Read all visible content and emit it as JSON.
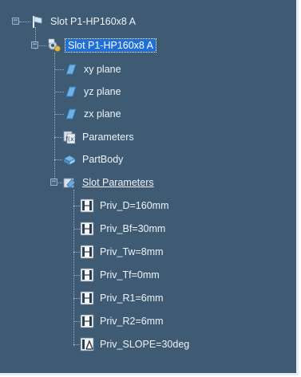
{
  "tree": {
    "root": {
      "label": "Slot P1-HP160x8 A",
      "icon": "part-flag-icon"
    },
    "part": {
      "label": "Slot P1-HP160x8 A",
      "icon": "part-gears-icon",
      "selected": true
    },
    "planes": [
      {
        "label": "xy plane",
        "icon": "plane-icon"
      },
      {
        "label": "yz plane",
        "icon": "plane-icon"
      },
      {
        "label": "zx plane",
        "icon": "plane-icon"
      }
    ],
    "parameters": {
      "label": "Parameters",
      "icon": "parameters-icon"
    },
    "partbody": {
      "label": "PartBody",
      "icon": "partbody-icon"
    },
    "slot_parameters": {
      "label": "Slot Parameters",
      "icon": "parameter-set-icon",
      "items": [
        {
          "label": "Priv_D=160mm",
          "icon": "length-parameter-icon"
        },
        {
          "label": "Priv_Bf=30mm",
          "icon": "length-parameter-icon"
        },
        {
          "label": "Priv_Tw=8mm",
          "icon": "length-parameter-icon"
        },
        {
          "label": "Priv_Tf=0mm",
          "icon": "length-parameter-icon"
        },
        {
          "label": "Priv_R1=6mm",
          "icon": "length-parameter-icon"
        },
        {
          "label": "Priv_R2=6mm",
          "icon": "length-parameter-icon"
        },
        {
          "label": "Priv_SLOPE=30deg",
          "icon": "angle-parameter-icon"
        }
      ]
    }
  },
  "colors": {
    "background": "#3f5a73",
    "selection": "#1e6fd9",
    "text": "#eef3f8"
  }
}
